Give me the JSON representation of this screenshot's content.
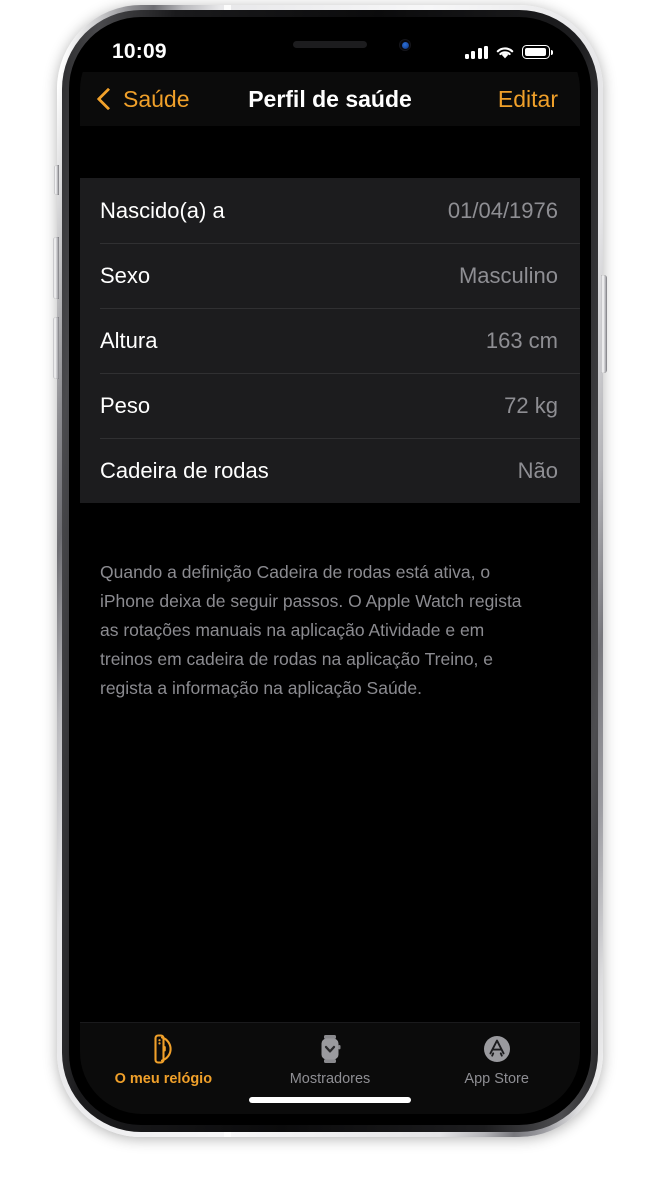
{
  "status_bar": {
    "time": "10:09",
    "signal_icon": "cellular-signal-icon",
    "wifi_icon": "wifi-icon",
    "battery_icon": "battery-icon"
  },
  "nav_bar": {
    "back_label": "Saúde",
    "back_icon": "chevron-left-icon",
    "title": "Perfil de saúde",
    "action_label": "Editar"
  },
  "profile_rows": [
    {
      "label": "Nascido(a) a",
      "value": "01/04/1976"
    },
    {
      "label": "Sexo",
      "value": "Masculino"
    },
    {
      "label": "Altura",
      "value": "163 cm"
    },
    {
      "label": "Peso",
      "value": "72 kg"
    },
    {
      "label": "Cadeira de rodas",
      "value": "Não"
    }
  ],
  "footer_note": "Quando a definição Cadeira de rodas está ativa, o iPhone deixa de seguir passos. O Apple Watch regista as rotações manuais na aplicação Atividade e em treinos em cadeira de rodas na aplicação Treino, e regista a informação na aplicação Saúde.",
  "tab_bar": {
    "tabs": [
      {
        "label": "O meu relógio",
        "icon": "watch-icon",
        "active": true
      },
      {
        "label": "Mostradores",
        "icon": "watch-face-icon",
        "active": false
      },
      {
        "label": "App Store",
        "icon": "app-store-icon",
        "active": false
      }
    ]
  },
  "colors": {
    "accent": "#f0a02a",
    "screen_background": "#000000",
    "card_background": "#1c1c1e",
    "primary_text": "#ffffff",
    "secondary_text": "#8e8e93",
    "separator": "#303032"
  }
}
